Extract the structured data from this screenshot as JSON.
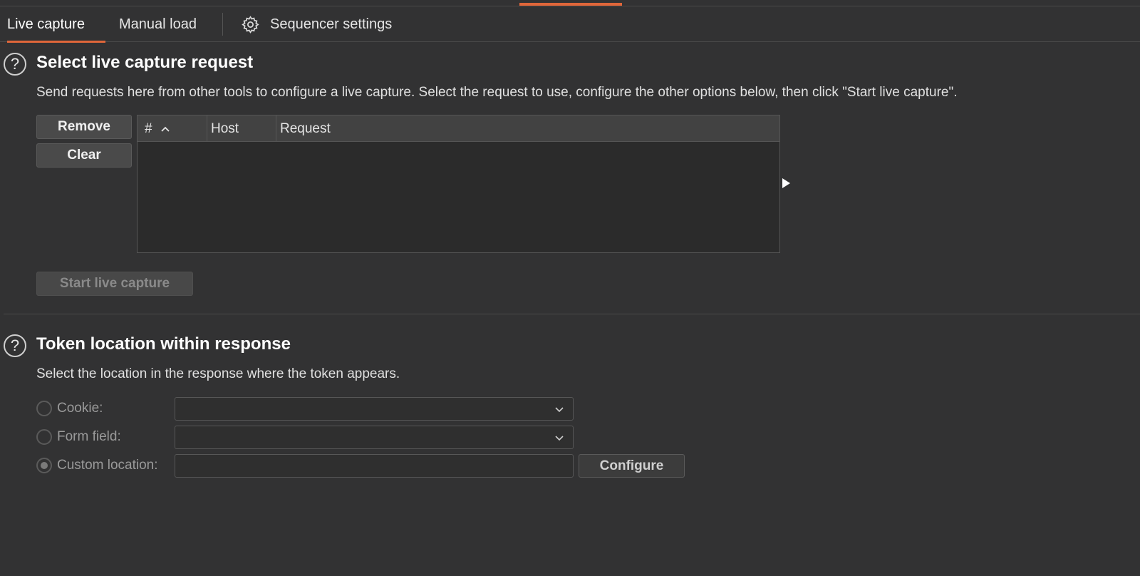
{
  "tabs": {
    "live_capture": "Live capture",
    "manual_load": "Manual load",
    "sequencer_settings": "Sequencer settings"
  },
  "section1": {
    "help": "?",
    "title": "Select live capture request",
    "description": "Send requests here from other tools to configure a live capture. Select the request to use, configure the other options below, then click \"Start live capture\".",
    "remove_button": "Remove",
    "clear_button": "Clear",
    "table": {
      "columns": [
        "#",
        "Host",
        "Request"
      ],
      "rows": []
    },
    "start_button": "Start live capture"
  },
  "section2": {
    "help": "?",
    "title": "Token location within response",
    "description": "Select the location in the response where the token appears.",
    "options": {
      "cookie_label": "Cookie:",
      "form_field_label": "Form field:",
      "custom_location_label": "Custom location:",
      "selected": "custom_location"
    },
    "custom_location_value": "",
    "configure_button": "Configure"
  },
  "colors": {
    "background": "#323233",
    "accent": "#e0663a"
  },
  "icons": {
    "settings": "gear-icon",
    "help": "help-circle-icon",
    "sort": "chevron-up-icon",
    "dropdown": "chevron-down-icon",
    "expand": "triangle-right-icon"
  }
}
